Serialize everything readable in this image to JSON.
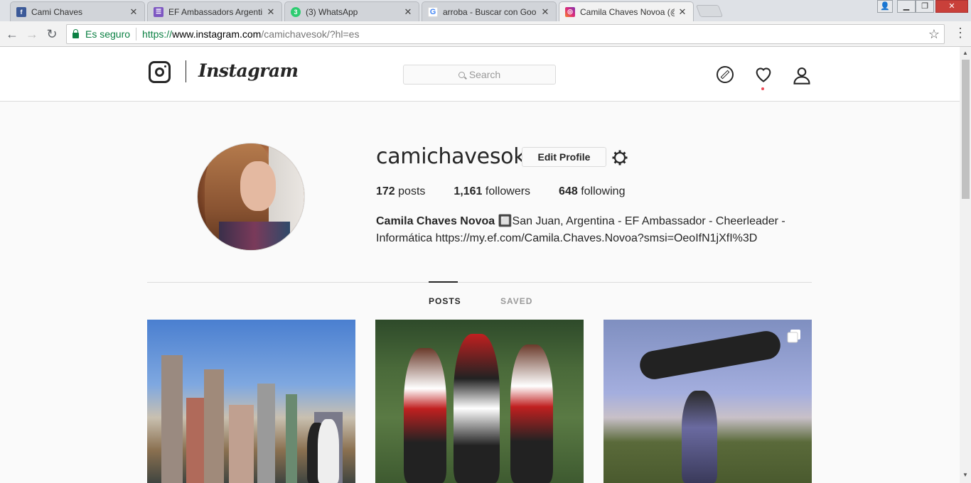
{
  "browser": {
    "tabs": [
      {
        "title": "Cami Chaves",
        "favicon": "facebook-icon",
        "color": "#3b5998",
        "active": false
      },
      {
        "title": "EF Ambassadors Argentin",
        "favicon": "forms-icon",
        "color": "#7e57c2",
        "active": false
      },
      {
        "title": "(3) WhatsApp",
        "favicon": "whatsapp-icon",
        "color": "#2ecc71",
        "badge": "3",
        "active": false
      },
      {
        "title": "arroba - Buscar con Goo",
        "favicon": "google-icon",
        "color": "#4285f4",
        "active": false
      },
      {
        "title": "Camila Chaves Novoa (@",
        "favicon": "instagram-icon",
        "color": "#c13584",
        "active": true
      }
    ],
    "security_label": "Es seguro",
    "url": {
      "proto": "https://",
      "host": "www.instagram.com",
      "path": "/camichavesok/?hl=es"
    }
  },
  "instagram": {
    "wordmark": "Instagram",
    "search_placeholder": "Search",
    "profile": {
      "username": "camichavesok",
      "edit_label": "Edit Profile",
      "posts_count": "172",
      "posts_label": "posts",
      "followers_count": "1,161",
      "followers_label": "followers",
      "following_count": "648",
      "following_label": "following",
      "full_name": "Camila Chaves Novoa",
      "bio_line1": " 🔲San Juan, Argentina - EF Ambassador - Cheerleader -",
      "bio_line2": "Informática https://my.ef.com/Camila.Chaves.Novoa?smsi=OeoIfN1jXfI%3D"
    },
    "tabs": {
      "posts": "POSTS",
      "saved": "SAVED"
    },
    "colors": {
      "text": "#262626",
      "muted": "#999999",
      "notification": "#ed4956"
    }
  }
}
